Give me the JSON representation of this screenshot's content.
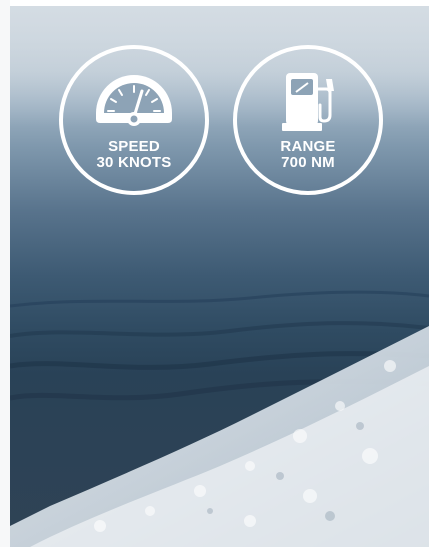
{
  "badges": {
    "speed": {
      "title": "SPEED",
      "value": "30 KNOTS",
      "icon": "speedometer-icon"
    },
    "range": {
      "title": "RANGE",
      "value": "700 NM",
      "icon": "fuel-pump-icon"
    }
  },
  "colors": {
    "badge_stroke": "#ffffff",
    "sea_deep": "#2f4b62",
    "sky": "#c9d3dc"
  }
}
